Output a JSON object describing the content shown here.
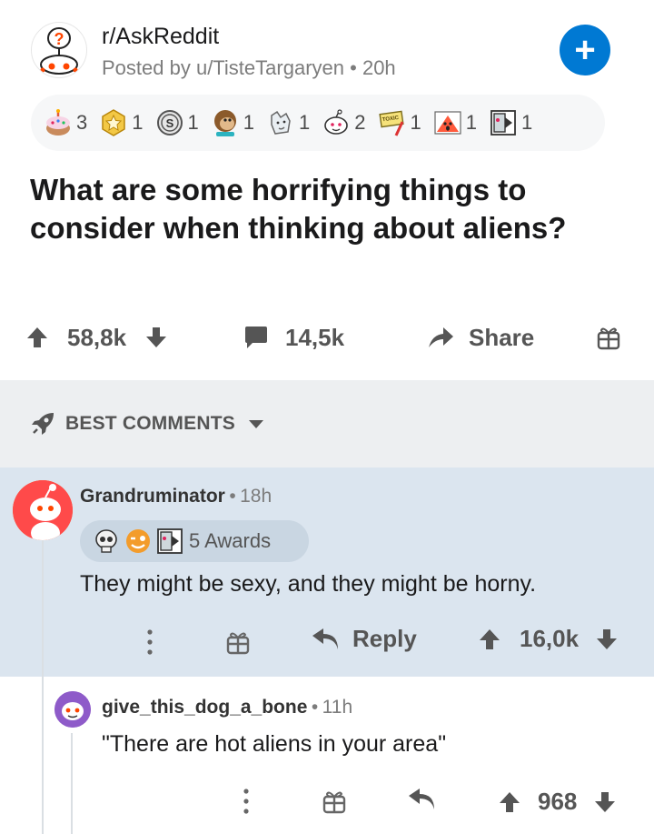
{
  "post": {
    "subreddit": "r/AskReddit",
    "meta_prefix": "Posted by u/TisteTargaryen",
    "meta_sep": "•",
    "meta_age": "20h",
    "join_symbol": "+",
    "awards": [
      {
        "icon": "birthday-cake-icon",
        "count": "3"
      },
      {
        "icon": "star-badge-icon",
        "count": "1"
      },
      {
        "icon": "silver-coin-icon",
        "count": "1"
      },
      {
        "icon": "monkey-icon",
        "count": "1"
      },
      {
        "icon": "wolf-icon",
        "count": "1"
      },
      {
        "icon": "snoo-face-icon",
        "count": "2"
      },
      {
        "icon": "toxic-sign-icon",
        "count": "1"
      },
      {
        "icon": "scream-face-icon",
        "count": "1"
      },
      {
        "icon": "door-exit-icon",
        "count": "1"
      }
    ],
    "title_line1": "What are some horrifying things to",
    "title_line2": "consider when thinking about aliens?",
    "upvotes": "58,8k",
    "comments": "14,5k",
    "share_label": "Share"
  },
  "sort": {
    "label": "BEST COMMENTS"
  },
  "comments": [
    {
      "author": "Grandruminator",
      "sep": "•",
      "age": "18h",
      "awards_label": "5 Awards",
      "body": "They might be sexy, and they might be horny.",
      "reply_label": "Reply",
      "score": "16,0k"
    },
    {
      "author": "give_this_dog_a_bone",
      "sep": "•",
      "age": "11h",
      "body": "\"There are hot aliens in your area\"",
      "score": "968"
    }
  ],
  "colors": {
    "accent": "#0079d3",
    "highlight": "#dbe5ef",
    "sort_bg": "#edeff1"
  }
}
